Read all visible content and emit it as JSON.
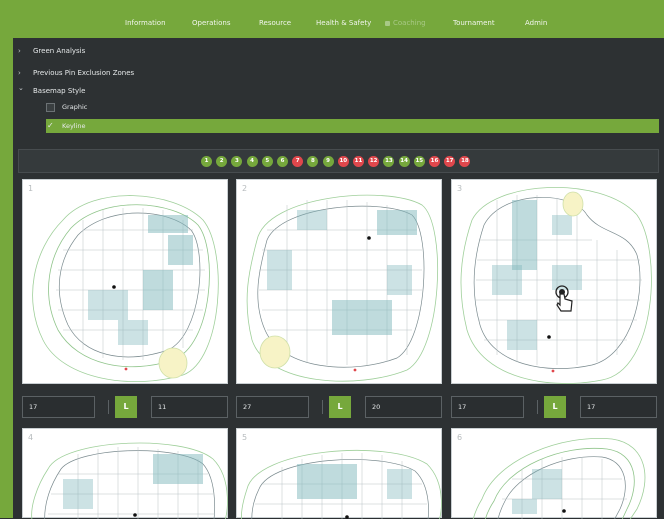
{
  "nav": {
    "items": [
      {
        "label": "Information"
      },
      {
        "label": "Operations"
      },
      {
        "label": "Resource"
      },
      {
        "label": "Health & Safety"
      },
      {
        "label": "Coaching",
        "disabled": true
      },
      {
        "label": "Tournament"
      },
      {
        "label": "Admin"
      }
    ]
  },
  "accordion": {
    "green_analysis": {
      "label": "Green Analysis",
      "chevron": "›"
    },
    "pin_exclusion": {
      "label": "Previous Pin Exclusion Zones",
      "chevron": "›"
    },
    "basemap_style": {
      "label": "Basemap Style",
      "chevron": "⌄"
    }
  },
  "basemap": {
    "options": [
      {
        "label": "Graphic",
        "checked": false
      },
      {
        "label": "Keyline",
        "checked": true,
        "tick": "✓"
      }
    ]
  },
  "holes": {
    "numbers": [
      "1",
      "2",
      "3",
      "4",
      "5",
      "6",
      "7",
      "8",
      "9",
      "10",
      "11",
      "12",
      "13",
      "14",
      "15",
      "16",
      "17",
      "18"
    ],
    "status": [
      "green",
      "green",
      "green",
      "green",
      "green",
      "green",
      "red",
      "green",
      "green",
      "red",
      "red",
      "red",
      "green",
      "green",
      "green",
      "red",
      "red",
      "red"
    ]
  },
  "colors": {
    "accent": "#76a83c",
    "hole_green": "#76a83c",
    "hole_red": "#e0474c",
    "panel": "#2d3133"
  },
  "cards": [
    {
      "number": "1",
      "left_value": "17",
      "toggle": "L",
      "right_value": "11"
    },
    {
      "number": "2",
      "left_value": "27",
      "toggle": "L",
      "right_value": "20"
    },
    {
      "number": "3",
      "left_value": "17",
      "toggle": "L",
      "right_value": "17"
    },
    {
      "number": "4"
    },
    {
      "number": "5"
    },
    {
      "number": "6"
    }
  ],
  "cursor": {
    "icon": "hand-pointer-icon"
  }
}
